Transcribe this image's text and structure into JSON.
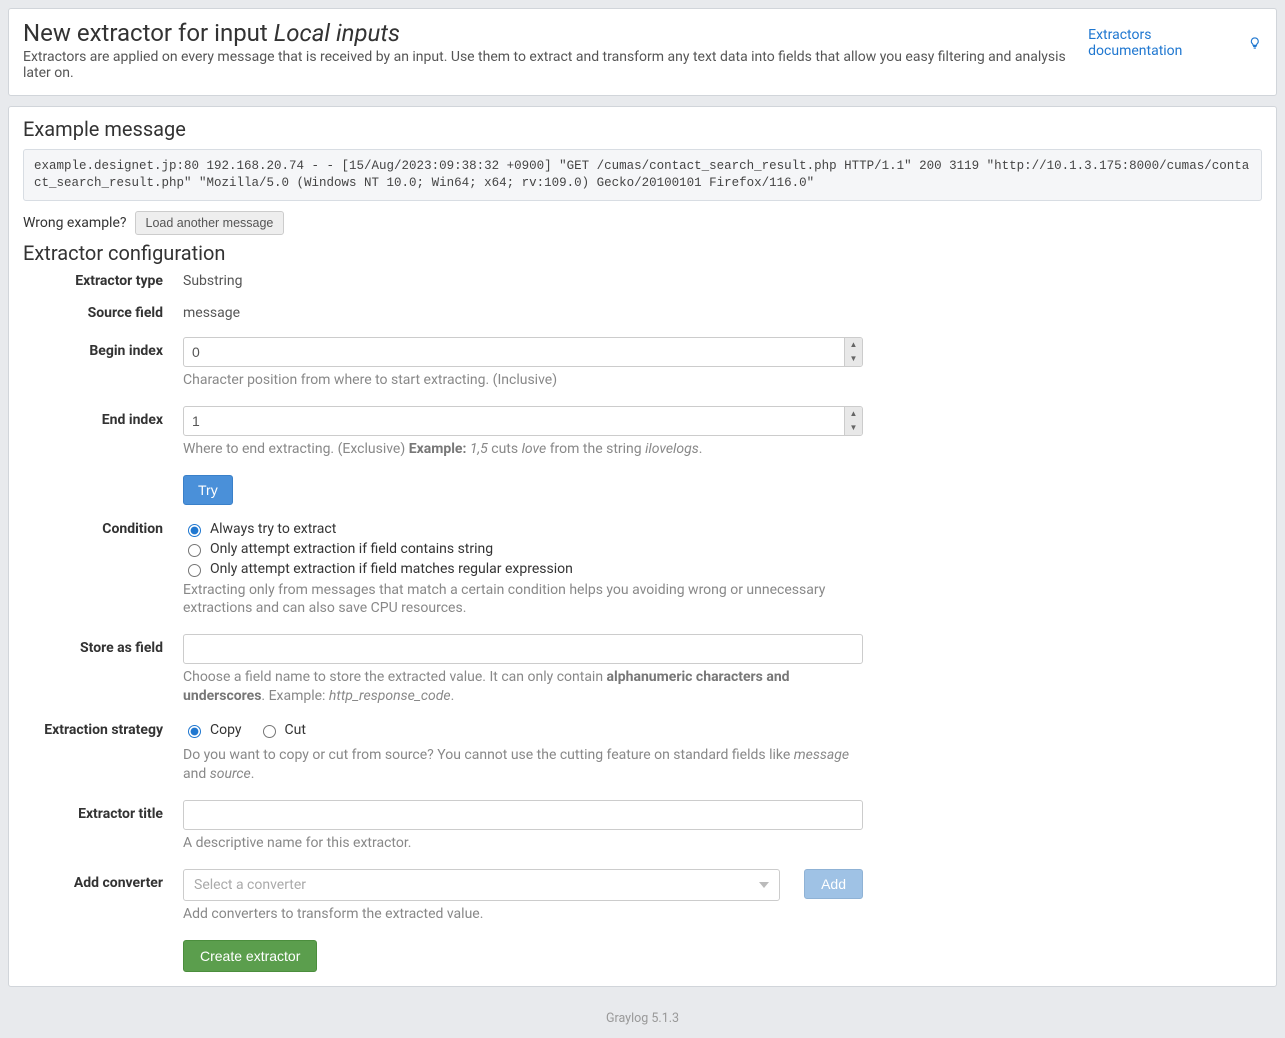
{
  "header": {
    "title_prefix": "New extractor for input ",
    "title_em": "Local inputs",
    "subtitle": "Extractors are applied on every message that is received by an input. Use them to extract and transform any text data into fields that allow you easy filtering and analysis later on.",
    "doc_link": "Extractors documentation"
  },
  "example": {
    "heading": "Example message",
    "content": "example.designet.jp:80 192.168.20.74 - - [15/Aug/2023:09:38:32 +0900] \"GET /cumas/contact_search_result.php HTTP/1.1\" 200 3119 \"http://10.1.3.175:8000/cumas/contact_search_result.php\" \"Mozilla/5.0 (Windows NT 10.0; Win64; x64; rv:109.0) Gecko/20100101 Firefox/116.0\"",
    "wrong_label": "Wrong example?",
    "load_button": "Load another message"
  },
  "config": {
    "heading": "Extractor configuration",
    "rows": {
      "extractor_type": {
        "label": "Extractor type",
        "value": "Substring"
      },
      "source_field": {
        "label": "Source field",
        "value": "message"
      },
      "begin_index": {
        "label": "Begin index",
        "value": "0",
        "help": "Character position from where to start extracting. (Inclusive)"
      },
      "end_index": {
        "label": "End index",
        "value": "1",
        "help_pre": "Where to end extracting. (Exclusive) ",
        "help_example_label": "Example:",
        "help_ex_val": " 1,5",
        "help_mid1": " cuts ",
        "help_em1": "love",
        "help_mid2": " from the string ",
        "help_em2": "ilovelogs",
        "help_end": "."
      },
      "try_button": "Try",
      "condition": {
        "label": "Condition",
        "opt_always": "Always try to extract",
        "opt_contains": "Only attempt extraction if field contains string",
        "opt_regex": "Only attempt extraction if field matches regular expression",
        "help": "Extracting only from messages that match a certain condition helps you avoiding wrong or unnecessary extractions and can also save CPU resources."
      },
      "store_as": {
        "label": "Store as field",
        "help_pre": "Choose a field name to store the extracted value. It can only contain ",
        "help_strong": "alphanumeric characters and underscores",
        "help_mid": ". Example: ",
        "help_em": "http_response_code",
        "help_end": "."
      },
      "strategy": {
        "label": "Extraction strategy",
        "opt_copy": "Copy",
        "opt_cut": "Cut",
        "help_pre": "Do you want to copy or cut from source? You cannot use the cutting feature on standard fields like ",
        "help_em1": "message",
        "help_mid": " and ",
        "help_em2": "source",
        "help_end": "."
      },
      "extractor_title": {
        "label": "Extractor title",
        "help": "A descriptive name for this extractor."
      },
      "add_converter": {
        "label": "Add converter",
        "placeholder": "Select a converter",
        "button": "Add",
        "help": "Add converters to transform the extracted value."
      },
      "create_button": "Create extractor"
    }
  },
  "footer": "Graylog 5.1.3"
}
